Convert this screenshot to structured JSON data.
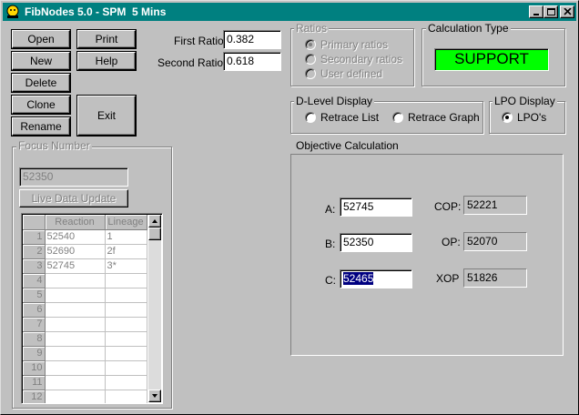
{
  "window": {
    "title": "FibNodes 5.0 - SPM  5 Mins",
    "icon": "fibnodes-app-icon",
    "controls": [
      "minimize-icon",
      "maximize-icon",
      "close-icon"
    ]
  },
  "buttons": {
    "open": "Open",
    "print": "Print",
    "new": "New",
    "help": "Help",
    "delete": "Delete",
    "clone": "Clone",
    "exit": "Exit",
    "rename": "Rename"
  },
  "ratios_input": {
    "first_label": "First Ratio",
    "first_value": "0.382",
    "second_label": "Second Ratio",
    "second_value": "0.618"
  },
  "ratios_group": {
    "title": "Ratios",
    "options": [
      "Primary ratios",
      "Secondary ratios",
      "User defined"
    ],
    "selected": "Primary ratios",
    "enabled": false
  },
  "calculation_type": {
    "title": "Calculation Type",
    "value": "SUPPORT",
    "color": "#00ff00"
  },
  "dlevel": {
    "title": "D-Level Display",
    "options": [
      "Retrace List",
      "Retrace Graph"
    ],
    "selected": null
  },
  "lpo": {
    "title": "LPO Display",
    "option": "LPO's",
    "selected": true
  },
  "focus": {
    "title": "Focus Number",
    "value": "52350",
    "update_button": "Live Data Update",
    "enabled": false,
    "columns": [
      "Reaction",
      "Lineage"
    ],
    "rows": [
      {
        "n": "1",
        "reaction": "52540",
        "lineage": "1"
      },
      {
        "n": "2",
        "reaction": "52690",
        "lineage": "2f"
      },
      {
        "n": "3",
        "reaction": "52745",
        "lineage": "3*"
      },
      {
        "n": "4",
        "reaction": "",
        "lineage": ""
      },
      {
        "n": "5",
        "reaction": "",
        "lineage": ""
      },
      {
        "n": "6",
        "reaction": "",
        "lineage": ""
      },
      {
        "n": "7",
        "reaction": "",
        "lineage": ""
      },
      {
        "n": "8",
        "reaction": "",
        "lineage": ""
      },
      {
        "n": "9",
        "reaction": "",
        "lineage": ""
      },
      {
        "n": "10",
        "reaction": "",
        "lineage": ""
      },
      {
        "n": "11",
        "reaction": "",
        "lineage": ""
      },
      {
        "n": "12",
        "reaction": "",
        "lineage": ""
      }
    ]
  },
  "objective": {
    "title": "Objective Calculation",
    "a_label": "A:",
    "a_value": "52745",
    "b_label": "B:",
    "b_value": "52350",
    "c_label": "C:",
    "c_value": "52465",
    "cop_label": "COP:",
    "cop_value": "52221",
    "op_label": "OP:",
    "op_value": "52070",
    "xop_label": "XOP",
    "xop_value": "51826"
  }
}
